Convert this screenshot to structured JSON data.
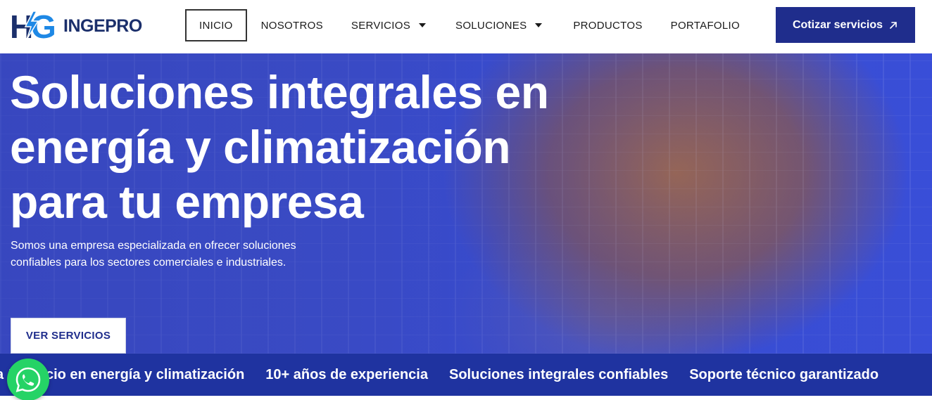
{
  "brand": {
    "logo_mark": "HG",
    "name": "INGEPRO",
    "colors": {
      "primary": "#1f2d8c",
      "accent": "#1e88e5",
      "band": "#1f33a0"
    }
  },
  "nav": {
    "items": [
      {
        "label": "INICIO",
        "active": true,
        "has_dropdown": false
      },
      {
        "label": "NOSOTROS",
        "active": false,
        "has_dropdown": false
      },
      {
        "label": "SERVICIOS",
        "active": false,
        "has_dropdown": true
      },
      {
        "label": "SOLUCIONES",
        "active": false,
        "has_dropdown": true
      },
      {
        "label": "PRODUCTOS",
        "active": false,
        "has_dropdown": false
      },
      {
        "label": "PORTAFOLIO",
        "active": false,
        "has_dropdown": false
      }
    ],
    "cta_label": "Cotizar servicios",
    "cta_icon": "arrow-up-right-icon"
  },
  "hero": {
    "title_lines": [
      "Soluciones integrales en",
      "energía y climatización",
      "para tu empresa"
    ],
    "subtitle_part1": "Somos una empresa especializada en ofrecer soluciones confiables para los sectores ",
    "subtitle_part2": "comerciales e industriales",
    "subtitle_part3": ".",
    "button_label": "VER SERVICIOS"
  },
  "band": {
    "items": [
      "Tu socio en energía y climatización",
      "10+ años de experiencia",
      "Soluciones integrales confiables",
      "Soporte técnico garantizado"
    ],
    "leading_fragment": "za"
  },
  "whatsapp": {
    "icon": "whatsapp-icon"
  }
}
